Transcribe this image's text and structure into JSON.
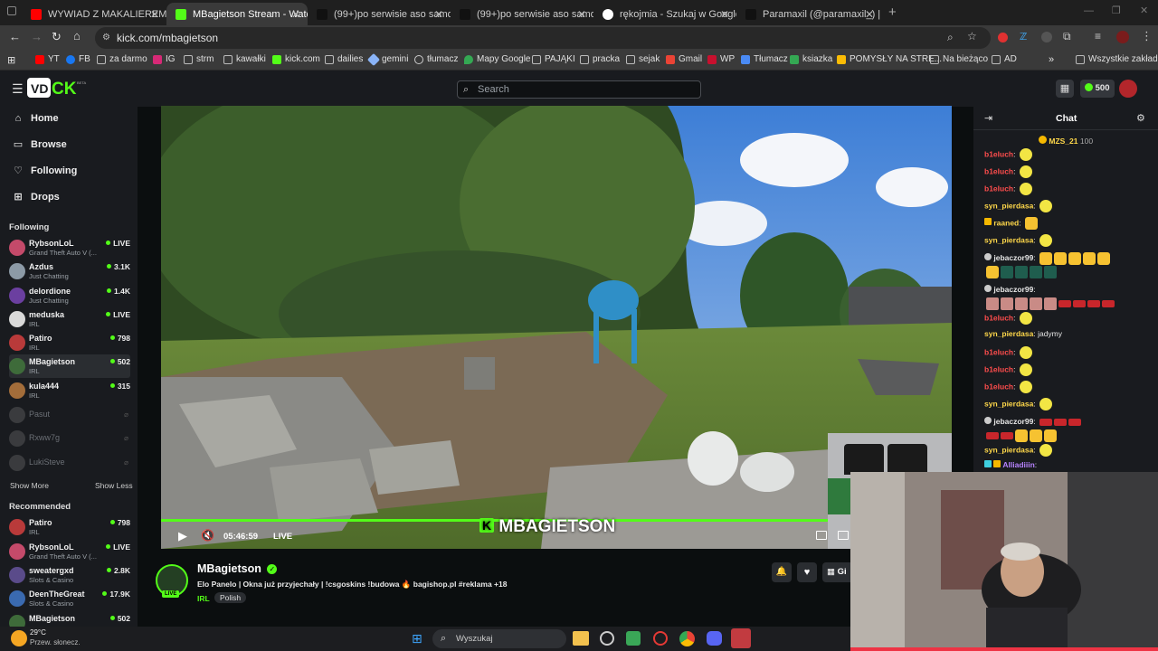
{
  "browser": {
    "tabs": [
      {
        "title": "WYWIAD Z MAKALIEREM: Hak",
        "color": "#ff0000"
      },
      {
        "title": "MBagietson Stream - Watch Live",
        "color": "#53fc18"
      },
      {
        "title": "(99+)po serwisie aso samochód",
        "color": "#222222"
      },
      {
        "title": "(99+)po serwisie aso samochód",
        "color": "#222222"
      },
      {
        "title": "rękojmia - Szukaj w Google",
        "color": "#ffffff"
      },
      {
        "title": "Paramaxil (@paramaxil_) | TikTo",
        "color": "#222222"
      }
    ],
    "url": "kick.com/mbagietson",
    "bookmarks": [
      "YT",
      "FB",
      "za darmo",
      "IG",
      "strm",
      "kawałki",
      "kick.com",
      "dailies",
      "gemini",
      "tłumacz",
      "Mapy Google",
      "PAJĄKI",
      "pracka",
      "sejak",
      "Gmail",
      "WP",
      "Tłumacz",
      "ksiazka",
      "POMYSŁY NA STRE...",
      "Na bieżąco",
      "AD"
    ],
    "all_bookmarks": "Wszystkie zakładki"
  },
  "header": {
    "search_placeholder": "Search",
    "kicks": "500"
  },
  "sidebar": {
    "nav": [
      {
        "label": "Home",
        "icon": "home-icon"
      },
      {
        "label": "Browse",
        "icon": "browse-icon"
      },
      {
        "label": "Following",
        "icon": "heart-icon"
      },
      {
        "label": "Drops",
        "icon": "drops-icon"
      }
    ],
    "following_title": "Following",
    "following": [
      {
        "name": "RybsonLoL",
        "sub": "Grand Theft Auto V (...",
        "viewers": "LIVE",
        "color": "#c44a6a"
      },
      {
        "name": "Azdus",
        "sub": "Just Chatting",
        "viewers": "3.1K",
        "color": "#8c9aa6"
      },
      {
        "name": "delordione",
        "sub": "Just Chatting",
        "viewers": "1.4K",
        "color": "#6b3fa0"
      },
      {
        "name": "meduska",
        "sub": "IRL",
        "viewers": "LIVE",
        "color": "#d9d9d9"
      },
      {
        "name": "Patiro",
        "sub": "IRL",
        "viewers": "798",
        "color": "#b93a3a"
      },
      {
        "name": "MBagietson",
        "sub": "IRL",
        "viewers": "502",
        "color": "#3e6b3a"
      },
      {
        "name": "kula444",
        "sub": "IRL",
        "viewers": "315",
        "color": "#a36d3a"
      }
    ],
    "offline": [
      "Pasut",
      "Rxww7g",
      "LukiSteve"
    ],
    "show_more": "Show More",
    "show_less": "Show Less",
    "recommended_title": "Recommended",
    "recommended": [
      {
        "name": "Patiro",
        "sub": "IRL",
        "viewers": "798",
        "color": "#b93a3a"
      },
      {
        "name": "RybsonLoL",
        "sub": "Grand Theft Auto V (...",
        "viewers": "LIVE",
        "color": "#c44a6a"
      },
      {
        "name": "sweatergxd",
        "sub": "Slots & Casino",
        "viewers": "2.8K",
        "color": "#5a4b8a"
      },
      {
        "name": "DeenTheGreat",
        "sub": "Slots & Casino",
        "viewers": "17.9K",
        "color": "#3a6ab0"
      },
      {
        "name": "MBagietson",
        "sub": "",
        "viewers": "502",
        "color": "#3e6b3a"
      }
    ]
  },
  "player": {
    "time": "05:46:59",
    "live": "LIVE",
    "overlay": "MBAGIETSON"
  },
  "stream": {
    "name": "MBagietson",
    "title": "Elo Panelo | Okna już przyjechały | !csgoskins !budowa 🔥 bagishop.pl #reklama +18",
    "category": "IRL",
    "tag": "Polish",
    "live_badge": "LIVE",
    "gift": "Gi"
  },
  "chat": {
    "title": "Chat",
    "pinned_user": "MZS_21",
    "pinned_count": "100",
    "messages": [
      {
        "user": "b1eluch",
        "color": "red",
        "text": "",
        "emotes": [
          "e"
        ]
      },
      {
        "user": "b1eluch",
        "color": "red",
        "text": "",
        "emotes": [
          "e"
        ]
      },
      {
        "user": "b1eluch",
        "color": "red",
        "text": "",
        "emotes": [
          "e"
        ]
      },
      {
        "user": "syn_pierdasa",
        "color": "yel",
        "text": "",
        "emotes": [
          "e"
        ]
      },
      {
        "user": "raaned",
        "color": "yel",
        "text": "",
        "emotes": [
          "c"
        ]
      },
      {
        "user": "syn_pierdasa",
        "color": "yel",
        "text": "",
        "emotes": [
          "e"
        ]
      },
      {
        "user": "jebaczor99",
        "color": "wht",
        "text": "",
        "emotes": [
          "c",
          "c",
          "c",
          "c",
          "c",
          "c",
          "d",
          "d",
          "d",
          "d"
        ]
      },
      {
        "user": "jebaczor99",
        "color": "wht",
        "text": "",
        "emotes": [
          "p",
          "p",
          "p",
          "p",
          "p",
          "r",
          "r",
          "r",
          "r"
        ]
      },
      {
        "user": "b1eluch",
        "color": "red",
        "text": "",
        "emotes": [
          "e"
        ]
      },
      {
        "user": "syn_pierdasa",
        "color": "yel",
        "text": "jadymy",
        "emotes": []
      },
      {
        "user": "b1eluch",
        "color": "red",
        "text": "",
        "emotes": [
          "e"
        ]
      },
      {
        "user": "b1eluch",
        "color": "red",
        "text": "",
        "emotes": [
          "e"
        ]
      },
      {
        "user": "b1eluch",
        "color": "red",
        "text": "",
        "emotes": [
          "e"
        ]
      },
      {
        "user": "syn_pierdasa",
        "color": "yel",
        "text": "",
        "emotes": [
          "e"
        ]
      },
      {
        "user": "jebaczor99",
        "color": "wht",
        "text": "",
        "emotes": [
          "r",
          "r",
          "r",
          "r",
          "r",
          "c",
          "c",
          "c"
        ]
      },
      {
        "user": "syn_pierdasa",
        "color": "yel",
        "text": "",
        "emotes": [
          "e"
        ]
      },
      {
        "user": "Alliadiiin",
        "color": "pur",
        "text": "",
        "emotes": []
      }
    ]
  },
  "taskbar": {
    "temp": "29°C",
    "weather": "Przew. słonecz.",
    "search": "Wyszukaj"
  }
}
